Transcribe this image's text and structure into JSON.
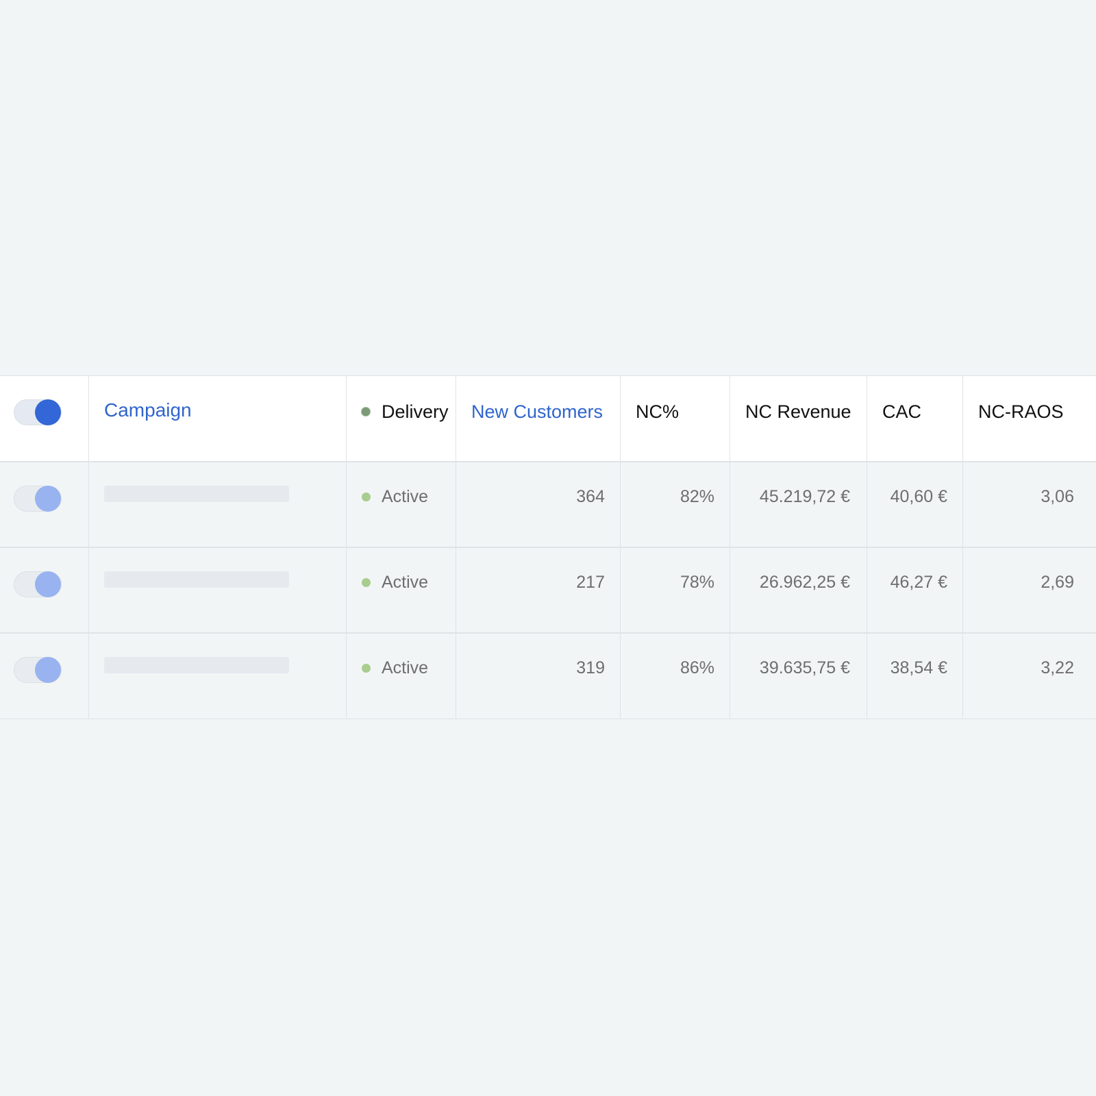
{
  "table": {
    "headers": {
      "campaign": "Campaign",
      "delivery": "Delivery",
      "new_customers": "New Customers",
      "nc_pct": "NC%",
      "nc_revenue": "NC Revenue",
      "cac": "CAC",
      "nc_raos": "NC-RAOS"
    },
    "master_toggle": {
      "on": true
    },
    "rows": [
      {
        "toggle_on": true,
        "campaign": "",
        "delivery": "Active",
        "new_customers": "364",
        "nc_pct": "82%",
        "nc_revenue": "45.219,72 €",
        "cac": "40,60 €",
        "nc_raos": "3,06"
      },
      {
        "toggle_on": true,
        "campaign": "",
        "delivery": "Active",
        "new_customers": "217",
        "nc_pct": "78%",
        "nc_revenue": "26.962,25 €",
        "cac": "46,27 €",
        "nc_raos": "2,69"
      },
      {
        "toggle_on": true,
        "campaign": "",
        "delivery": "Active",
        "new_customers": "319",
        "nc_pct": "86%",
        "nc_revenue": "39.635,75 €",
        "cac": "38,54 €",
        "nc_raos": "3,22"
      }
    ]
  },
  "colors": {
    "link": "#2f64cc",
    "toggle_active": "#3366d6",
    "toggle_row": "#98b3ef",
    "status_active": "#a8cd8e",
    "background": "#f2f5f6"
  },
  "icons": {
    "delivery_header": "status-dot-icon",
    "row_status": "active-dot-icon"
  }
}
